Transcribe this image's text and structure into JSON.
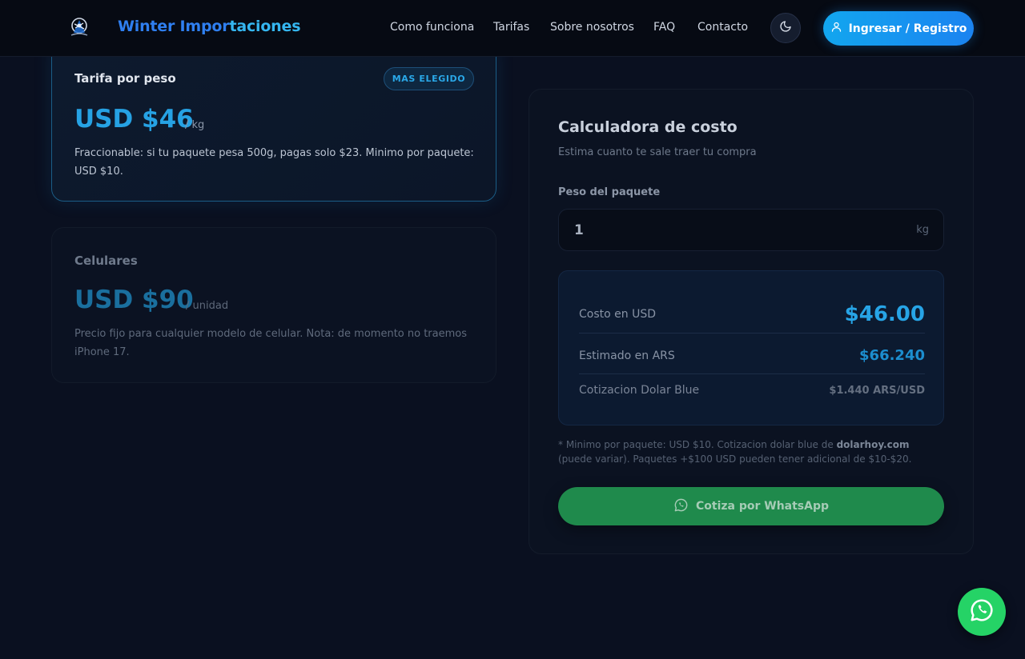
{
  "navbar": {
    "brand_part1": "Winter Impor",
    "brand_part2": "taciones",
    "links": [
      "Como funciona",
      "Tarifas",
      "Sobre nosotros",
      "FAQ",
      "Contacto"
    ],
    "login_label": "Ingresar / Registro"
  },
  "pricing": {
    "weight_card": {
      "title": "Tarifa por peso",
      "badge": "MAS ELEGIDO",
      "price": "USD $46",
      "unit": "/ kg",
      "description": "Fraccionable: si tu paquete pesa 500g, pagas solo $23. Minimo por paquete: USD $10."
    },
    "phone_card": {
      "title": "Celulares",
      "price": "USD $90",
      "unit": "/ unidad",
      "description": "Precio fijo para cualquier modelo de celular. Nota: de momento no traemos iPhone 17."
    }
  },
  "calculator": {
    "title": "Calculadora de costo",
    "subtitle": "Estima cuanto te sale traer tu compra",
    "weight_label": "Peso del paquete",
    "weight_value": "1",
    "weight_unit": "kg",
    "rows": [
      {
        "label": "Costo en USD",
        "value": "$46.00"
      },
      {
        "label": "Estimado en ARS",
        "value": "$66.240"
      },
      {
        "label": "Cotizacion Dolar Blue",
        "value": "$1.440 ARS/USD"
      }
    ],
    "note_prefix": "* Minimo por paquete: USD $10. Cotizacion dolar blue de ",
    "note_source": "dolarhoy.com",
    "note_suffix": " (puede variar). Paquetes +$100 USD pueden tener adicional de $10-$20.",
    "whatsapp_label": "Cotiza por WhatsApp"
  },
  "colors": {
    "accent": "#26a2e4",
    "brand_blue": "#2f7ff0",
    "whatsapp": "#25d366",
    "background": "#0a1020"
  },
  "icons": {
    "logo": "logo-icon",
    "theme": "moon-icon",
    "login": "user-icon",
    "whatsapp": "whatsapp-icon"
  }
}
